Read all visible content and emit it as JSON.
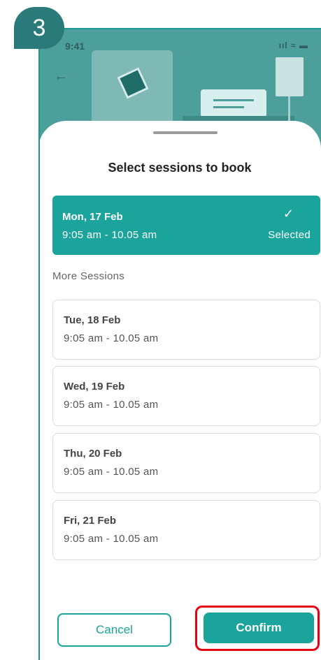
{
  "step": {
    "number": "3"
  },
  "status_bar": {
    "time": "9:41",
    "icons_text": "ııl ≈ ▬"
  },
  "sheet": {
    "title": "Select sessions to book",
    "selected_session": {
      "date": "Mon, 17 Feb",
      "time": "9:05 am - 10.05 am",
      "status": "Selected"
    },
    "more_label": "More Sessions",
    "sessions": [
      {
        "date": "Tue, 18 Feb",
        "time": "9:05 am - 10.05 am"
      },
      {
        "date": "Wed, 19 Feb",
        "time": "9:05 am - 10.05 am"
      },
      {
        "date": "Thu, 20 Feb",
        "time": "9:05 am - 10.05 am"
      },
      {
        "date": "Fri, 21 Feb",
        "time": "9:05 am - 10.05 am"
      }
    ],
    "cancel_label": "Cancel",
    "confirm_label": "Confirm"
  },
  "icons": [
    "back-arrow-icon",
    "check-icon",
    "signal-icon",
    "wifi-icon",
    "battery-icon"
  ],
  "colors": {
    "primary": "#1aa49c",
    "badge": "#2a7a7a",
    "hero": "#4d9f9b",
    "highlight": "#e60012"
  }
}
